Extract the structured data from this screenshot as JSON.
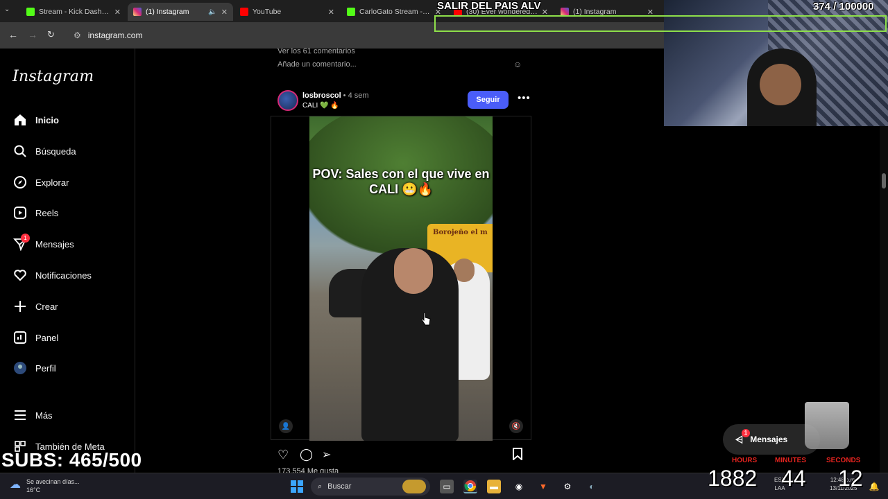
{
  "browser": {
    "tabs": [
      {
        "label": "Stream - Kick Dashboa",
        "color": "#53fc18"
      },
      {
        "label": "(1) Instagram",
        "color": "#d62976"
      },
      {
        "label": "YouTube",
        "color": "#ff0000"
      },
      {
        "label": "CarloGato Stream - W",
        "color": "#53fc18"
      },
      {
        "label": "(30) Ever wondered wh",
        "color": "#ff0000"
      },
      {
        "label": "(1) Instagram",
        "color": "#d62976"
      }
    ],
    "url": "instagram.com"
  },
  "instagram": {
    "logo": "Instagram",
    "nav": [
      {
        "label": "Inicio",
        "icon": "home-icon"
      },
      {
        "label": "Búsqueda",
        "icon": "search-icon"
      },
      {
        "label": "Explorar",
        "icon": "compass-icon"
      },
      {
        "label": "Reels",
        "icon": "reels-icon"
      },
      {
        "label": "Mensajes",
        "icon": "messenger-icon",
        "badge": "1"
      },
      {
        "label": "Notificaciones",
        "icon": "heart-icon"
      },
      {
        "label": "Crear",
        "icon": "plus-icon"
      },
      {
        "label": "Panel",
        "icon": "chart-icon"
      },
      {
        "label": "Perfil",
        "icon": "avatar-icon"
      }
    ],
    "more": "Más",
    "also_meta": "También de Meta",
    "prev_post": {
      "view_comments": "Ver los 61 comentarios",
      "add_comment": "Añade un comentario..."
    },
    "post": {
      "username": "losbroscol",
      "time": " • 4 sem",
      "caption": "CALI 💚 🔥",
      "follow": "Seguir",
      "overlay_text": "POV: Sales con el que vive en CALI 😬🔥",
      "stall_sign": "Borojeño el m",
      "likes": "173.554 Me gusta"
    },
    "messages_pill": {
      "label": "Mensajes",
      "badge": "1"
    }
  },
  "stream": {
    "goal_title": "SALIR DEL PAIS ALV",
    "goal_count": "374  / 100000",
    "subs": "SUBS: 465/500",
    "timer": {
      "hours_label": "HOURS",
      "minutes_label": "MINUTES",
      "seconds_label": "SECONDS",
      "hours": "1882",
      "minutes": "44",
      "seconds": "12"
    }
  },
  "taskbar": {
    "weather_title": "Se avecinan días...",
    "weather_temp": "16°C",
    "search": "Buscar",
    "lang": "ESP",
    "lang2": "LAA",
    "time": "12:48 p.m.",
    "date": "13/11/2025"
  }
}
